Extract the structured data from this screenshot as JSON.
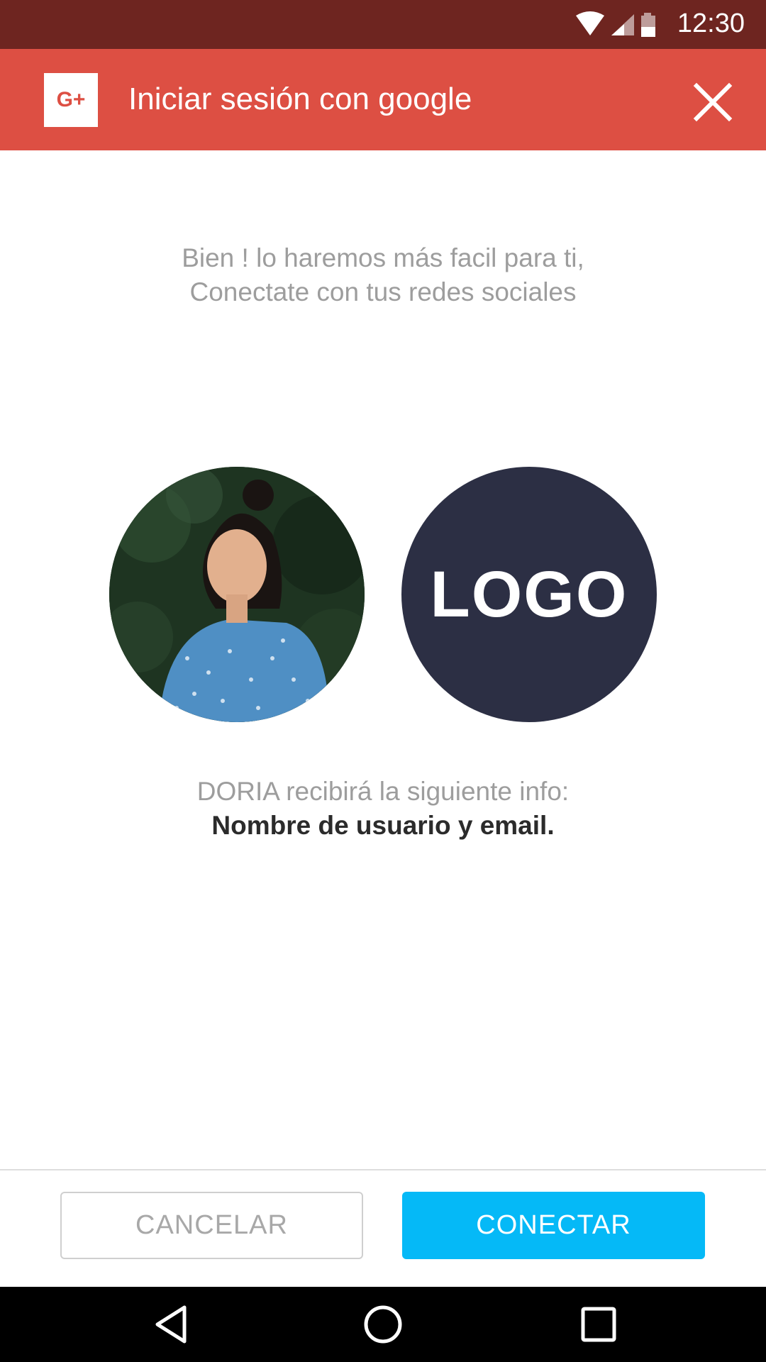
{
  "status_bar": {
    "time": "12:30",
    "icons": [
      "wifi-icon",
      "signal-icon",
      "battery-icon"
    ]
  },
  "app_bar": {
    "badge_text": "G+",
    "title": "Iniciar sesión con google",
    "close_icon": "close-icon",
    "color": "#dd4f43"
  },
  "intro": {
    "line1": "Bien ! lo haremos más facil para ti,",
    "line2": "Conectate con tus redes sociales"
  },
  "logo": {
    "text": "LOGO"
  },
  "info": {
    "line1": "DORIA recibirá la siguiente info:",
    "line2": "Nombre de usuario y email."
  },
  "buttons": {
    "cancel": "CANCELAR",
    "connect": "CONECTAR",
    "connect_color": "#05b9f7"
  },
  "nav": {
    "icons": [
      "back-icon",
      "home-icon",
      "recents-icon"
    ]
  }
}
